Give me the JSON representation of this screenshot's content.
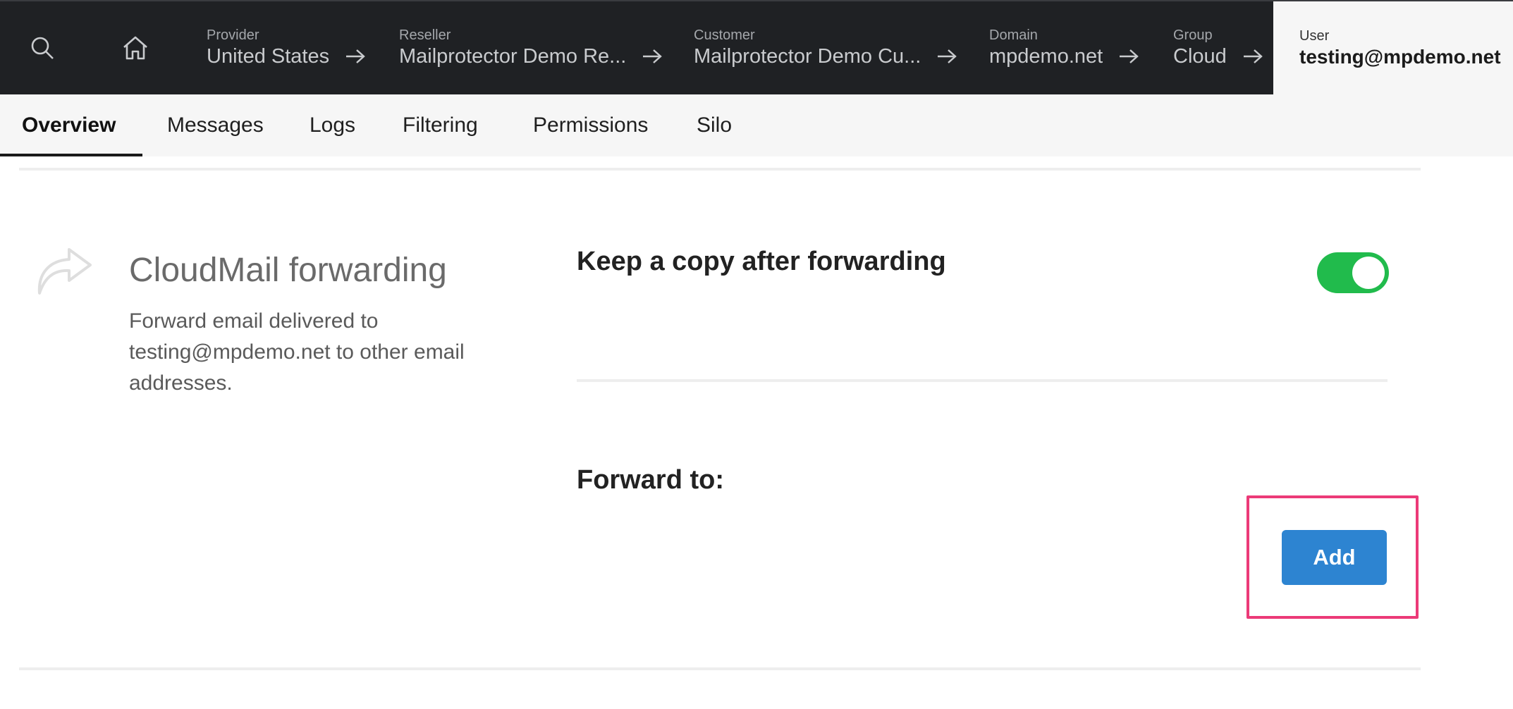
{
  "navbar": {
    "search_icon": "search-icon",
    "home_icon": "home-icon",
    "crumbs": [
      {
        "label": "Provider",
        "value": "United States"
      },
      {
        "label": "Reseller",
        "value": "Mailprotector Demo Re..."
      },
      {
        "label": "Customer",
        "value": "Mailprotector Demo Cu..."
      },
      {
        "label": "Domain",
        "value": "mpdemo.net"
      },
      {
        "label": "Group",
        "value": "Cloud"
      }
    ],
    "user": {
      "label": "User",
      "value": "testing@mpdemo.net"
    }
  },
  "tabs": [
    {
      "label": "Overview",
      "active": true
    },
    {
      "label": "Messages"
    },
    {
      "label": "Logs"
    },
    {
      "label": "Filtering"
    },
    {
      "label": "Permissions"
    },
    {
      "label": "Silo"
    }
  ],
  "section": {
    "icon": "forward-icon",
    "title": "CloudMail forwarding",
    "description": "Forward email delivered to testing@mpdemo.net to other email addresses.",
    "keep_copy_label": "Keep a copy after forwarding",
    "keep_copy_enabled": true,
    "forward_to_label": "Forward to:",
    "add_button_label": "Add"
  },
  "colors": {
    "navbar_bg": "#1f2124",
    "toggle_on": "#21bb4c",
    "primary_button": "#2d84d1",
    "highlight": "#ec3a78"
  }
}
